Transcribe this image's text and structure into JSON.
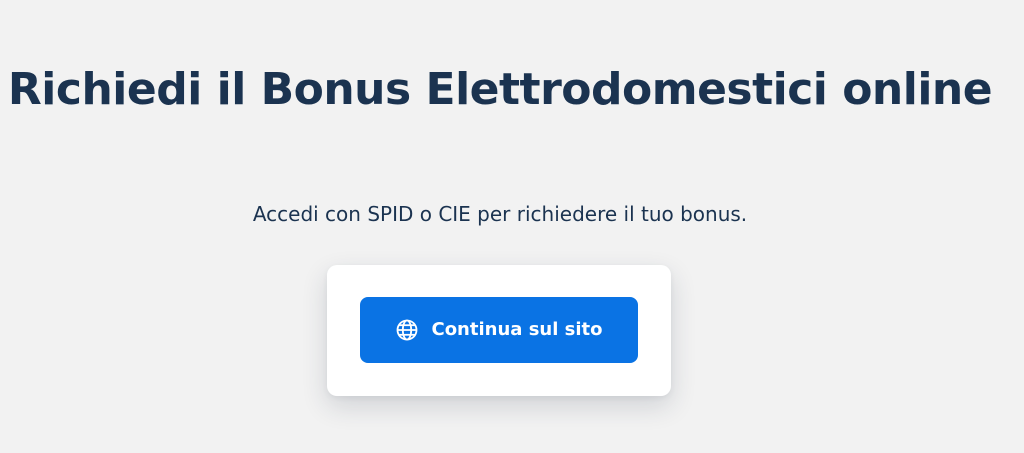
{
  "hero": {
    "title": "Richiedi il Bonus Elettrodomestici online",
    "subtitle": "Accedi con SPID o CIE per richiedere il tuo bonus."
  },
  "card": {
    "button": {
      "label": "Continua sul sito",
      "icon": "globe-icon"
    }
  },
  "colors": {
    "background": "#f2f2f2",
    "title": "#1b3350",
    "button": "#0a73e4",
    "button_text": "#ffffff",
    "card": "#ffffff"
  }
}
